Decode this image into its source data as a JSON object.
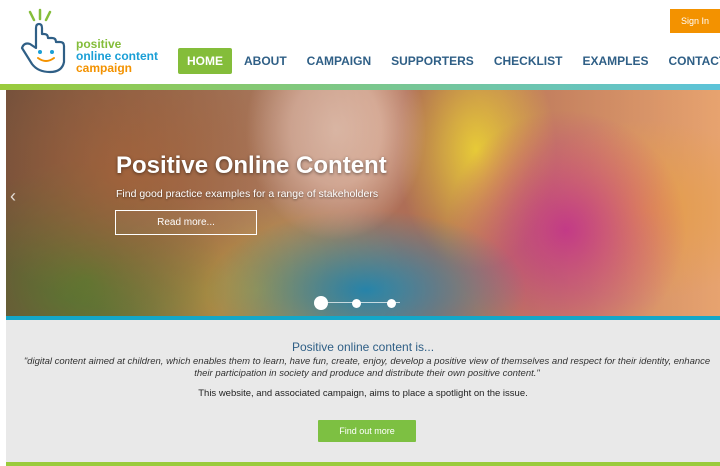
{
  "logo": {
    "line1": "positive",
    "line2": "online content",
    "line3": "campaign"
  },
  "signin_label": "Sign In",
  "nav": {
    "items": [
      {
        "label": "HOME",
        "active": true
      },
      {
        "label": "ABOUT"
      },
      {
        "label": "CAMPAIGN"
      },
      {
        "label": "SUPPORTERS"
      },
      {
        "label": "CHECKLIST"
      },
      {
        "label": "EXAMPLES"
      },
      {
        "label": "CONTACT US"
      }
    ]
  },
  "hero": {
    "title": "Positive Online Content",
    "subtitle": "Find good practice examples for a range of stakeholders",
    "button": "Read more...",
    "prev_icon": "‹",
    "slides": 3,
    "active_slide": 1
  },
  "intro": {
    "title": "Positive online content is...",
    "quote": "\"digital content aimed at children, which enables them to learn, have fun, create, enjoy, develop a positive view of themselves and respect for their identity, enhance their participation in society and produce and distribute their own positive content.\"",
    "note": "This website, and associated campaign, aims to place a spotlight on the issue.",
    "button": "Find out more"
  },
  "colors": {
    "green": "#84bd3a",
    "blue": "#2f5f86",
    "orange": "#f39200",
    "teal": "#14a7c8"
  },
  "icons": [
    "hand-pointer-logo-icon",
    "chevron-left-icon",
    "slide-dot-icon"
  ]
}
